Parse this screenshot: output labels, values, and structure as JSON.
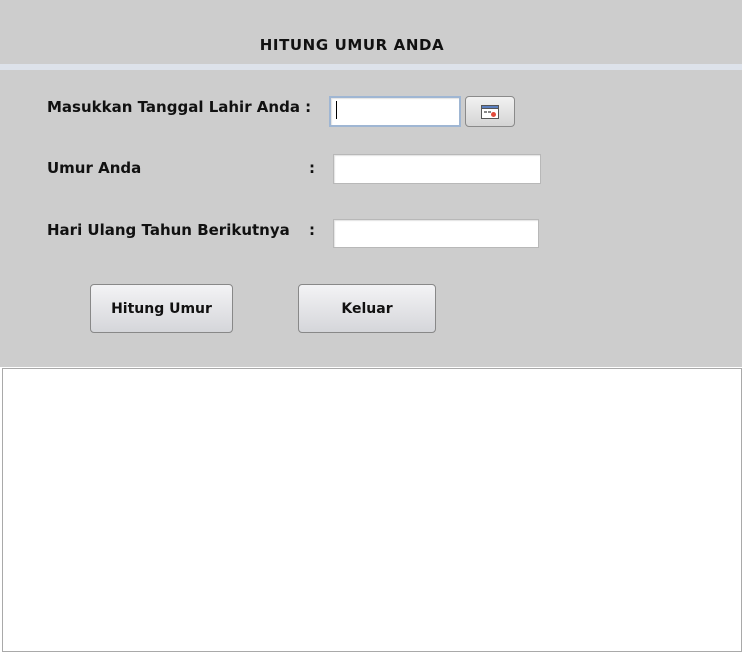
{
  "form": {
    "title": "HITUNG UMUR ANDA",
    "birth_date_label": "Masukkan Tanggal Lahir Anda :",
    "birth_date_value": "",
    "age_label": "Umur Anda",
    "age_value": "",
    "next_birthday_label": "Hari Ulang Tahun Berikutnya",
    "next_birthday_value": "",
    "colon": ":"
  },
  "buttons": {
    "calculate_label": "Hitung Umur",
    "exit_label": "Keluar"
  },
  "output": {
    "text": ""
  },
  "icons": {
    "calendar": "calendar-icon"
  }
}
